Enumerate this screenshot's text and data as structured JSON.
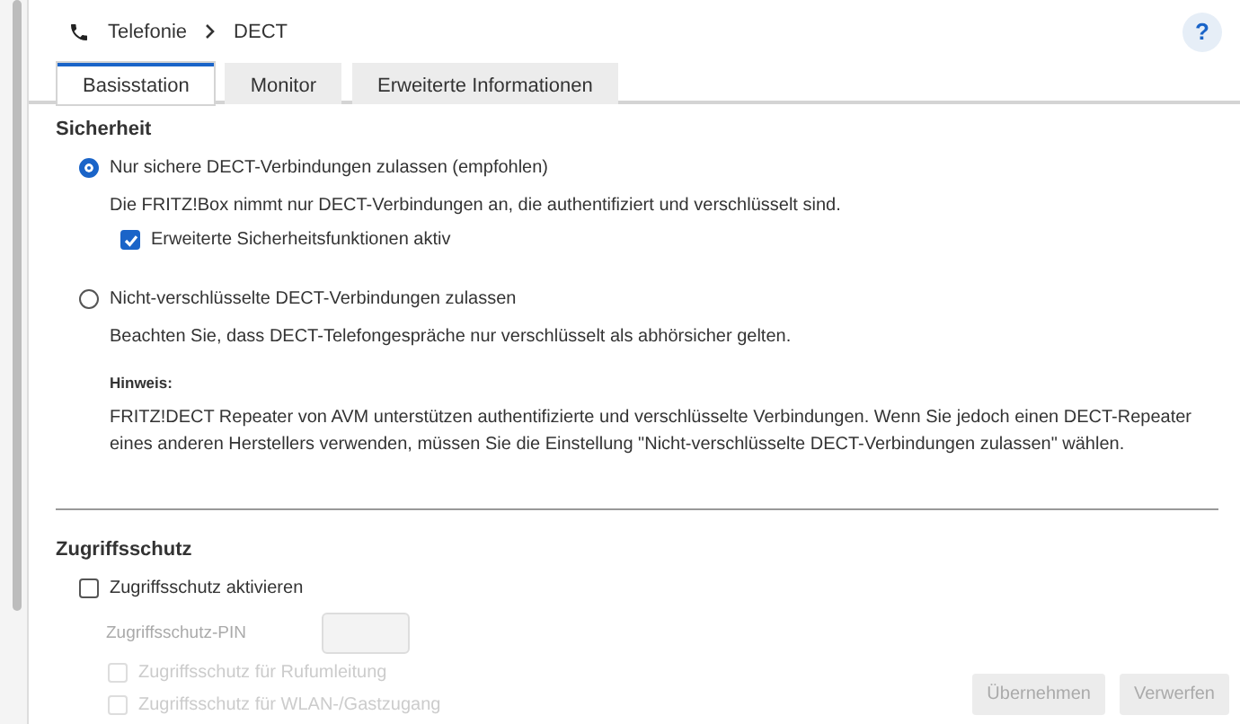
{
  "breadcrumb": {
    "items": [
      "Telefonie",
      "DECT"
    ],
    "help": "?"
  },
  "tabs": [
    {
      "label": "Basisstation",
      "selected": true
    },
    {
      "label": "Monitor",
      "selected": false
    },
    {
      "label": "Erweiterte Informationen",
      "selected": false
    }
  ],
  "security": {
    "title": "Sicherheit",
    "options": [
      {
        "label": "Nur sichere DECT-Verbindungen zulassen (empfohlen)",
        "selected": true,
        "description": "Die FRITZ!Box nimmt nur DECT-Verbindungen an, die authentifiziert und verschlüsselt sind.",
        "checkbox": {
          "label": "Erweiterte Sicherheitsfunktionen aktiv",
          "checked": true
        }
      },
      {
        "label": "Nicht-verschlüsselte DECT-Verbindungen zulassen",
        "selected": false,
        "description": "Beachten Sie, dass DECT-Telefongespräche nur verschlüsselt als abhörsicher gelten.",
        "hint": {
          "title": "Hinweis:",
          "text": "FRITZ!DECT Repeater von AVM unterstützen authentifizierte und verschlüsselte Verbindungen. Wenn Sie jedoch einen DECT-Repeater eines anderen Herstellers verwenden, müssen Sie die Einstellung \"Nicht-verschlüsselte DECT-Verbindungen zulassen\" wählen."
        }
      }
    ]
  },
  "access": {
    "title": "Zugriffsschutz",
    "enable": {
      "label": "Zugriffsschutz aktivieren",
      "checked": false
    },
    "pin": {
      "label": "Zugriffsschutz-PIN",
      "disabled": true
    },
    "options": [
      {
        "label": "Zugriffsschutz für Rufumleitung",
        "checked": false,
        "disabled": true
      },
      {
        "label": "Zugriffsschutz für WLAN-/Gastzugang",
        "checked": false,
        "disabled": true
      }
    ]
  },
  "buttons": [
    {
      "label": "Übernehmen",
      "disabled": true
    },
    {
      "label": "Verwerfen",
      "disabled": true
    }
  ]
}
